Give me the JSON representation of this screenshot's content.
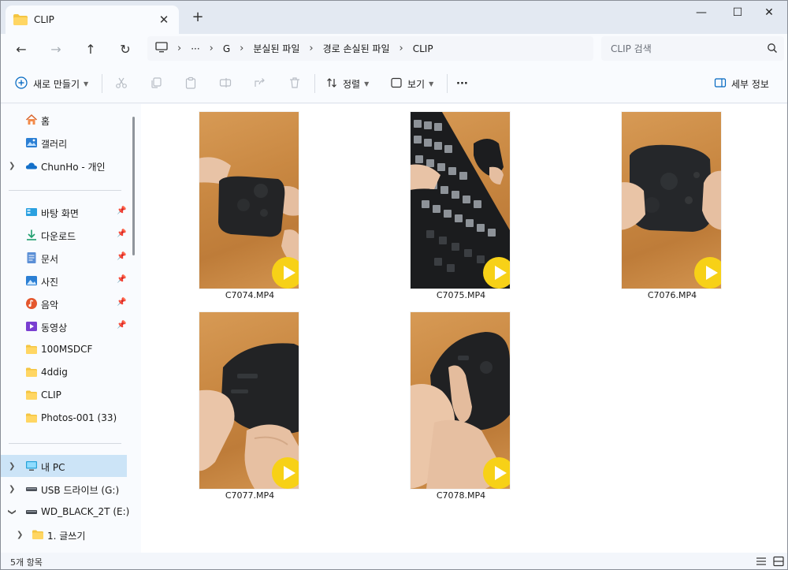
{
  "window": {
    "tab_title": "CLIP",
    "new_tab": "+",
    "tab_close": "✕",
    "minimize": "—",
    "maximize": "☐",
    "close": "✕"
  },
  "nav": {
    "back": "←",
    "forward": "→",
    "up": "↑",
    "refresh": "↻"
  },
  "address": {
    "overflow": "···",
    "crumbs": [
      "G",
      "분실된 파일",
      "경로 손실된 파일",
      "CLIP"
    ],
    "separator": "›"
  },
  "search": {
    "placeholder": "CLIP 검색"
  },
  "toolbar": {
    "new_label": "새로 만들기",
    "sort_label": "정렬",
    "view_label": "보기",
    "more_label": "···",
    "details_label": "세부 정보"
  },
  "sidebar": {
    "items": [
      {
        "label": "홈",
        "icon": "home-icon"
      },
      {
        "label": "갤러리",
        "icon": "gallery-icon"
      },
      {
        "label": "ChunHo - 개인",
        "icon": "onedrive-cloud-icon"
      },
      {
        "label": "바탕 화면",
        "icon": "desktop-icon",
        "pinned": true
      },
      {
        "label": "다운로드",
        "icon": "download-icon",
        "pinned": true
      },
      {
        "label": "문서",
        "icon": "documents-icon",
        "pinned": true
      },
      {
        "label": "사진",
        "icon": "pictures-icon",
        "pinned": true
      },
      {
        "label": "음악",
        "icon": "music-icon",
        "pinned": true
      },
      {
        "label": "동영상",
        "icon": "videos-icon",
        "pinned": true
      },
      {
        "label": "100MSDCF",
        "icon": "folder-icon"
      },
      {
        "label": "4ddig",
        "icon": "folder-icon"
      },
      {
        "label": "CLIP",
        "icon": "folder-icon"
      },
      {
        "label": "Photos-001 (33)",
        "icon": "folder-icon"
      },
      {
        "label": "내 PC",
        "icon": "this-pc-icon",
        "selected": true
      },
      {
        "label": "USB 드라이브 (G:)",
        "icon": "usb-drive-icon"
      },
      {
        "label": "WD_BLACK_2T (E:)",
        "icon": "hard-drive-icon"
      },
      {
        "label": "1. 글쓰기",
        "icon": "folder-icon"
      }
    ],
    "pin_glyph": "📌"
  },
  "files": [
    {
      "name": "C7074.MP4",
      "scene": "controller-top"
    },
    {
      "name": "C7075.MP4",
      "scene": "keyboard-mouse"
    },
    {
      "name": "C7076.MP4",
      "scene": "controller-held"
    },
    {
      "name": "C7077.MP4",
      "scene": "controller-side"
    },
    {
      "name": "C7078.MP4",
      "scene": "controller-grip"
    }
  ],
  "status": {
    "count_text": "5개 항목"
  },
  "colors": {
    "accent": "#0067c0",
    "selected_bg": "#cce4f7",
    "play_badge": "#f7d117",
    "folder": "#f4c542"
  }
}
